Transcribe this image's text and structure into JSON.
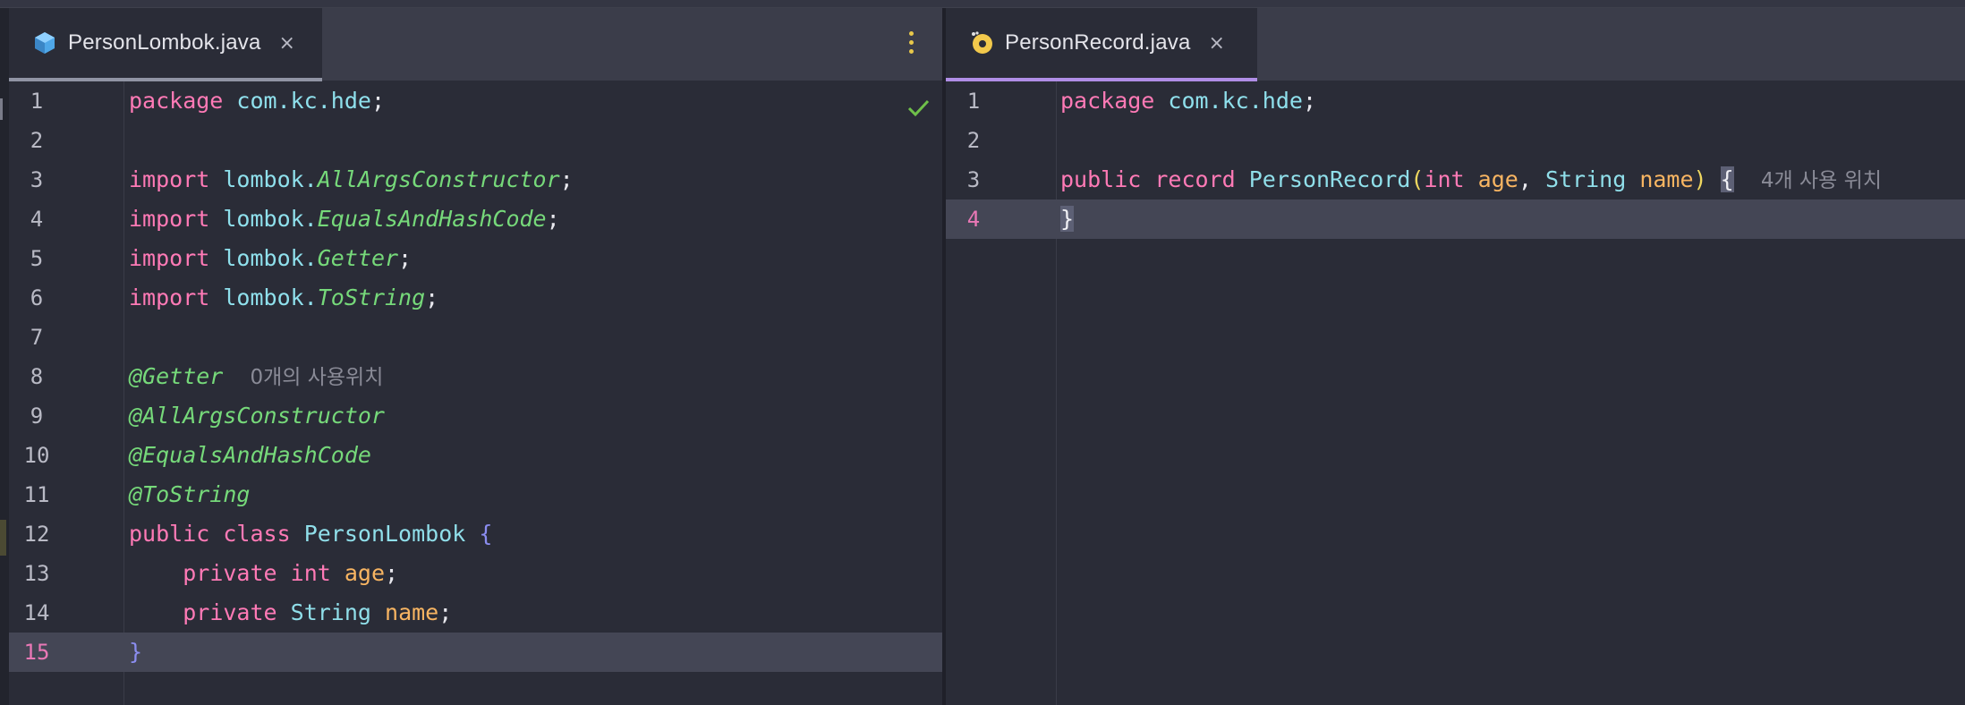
{
  "editor": {
    "left": {
      "tab": {
        "label": "PersonLombok.java",
        "close": "×",
        "icon": "java-class-icon"
      },
      "menu_icon": "vertical-ellipsis-icon",
      "status_icon": "checkmark-icon",
      "current_line": "15",
      "lines": [
        {
          "n": "1"
        },
        {
          "n": "2"
        },
        {
          "n": "3"
        },
        {
          "n": "4"
        },
        {
          "n": "5"
        },
        {
          "n": "6"
        },
        {
          "n": "7"
        },
        {
          "n": "8"
        },
        {
          "n": "9"
        },
        {
          "n": "10"
        },
        {
          "n": "11"
        },
        {
          "n": "12"
        },
        {
          "n": "13"
        },
        {
          "n": "14"
        },
        {
          "n": "15"
        }
      ],
      "tokens": {
        "package": "package",
        "pkg_name": "com.kc.hde",
        "semicolon": ";",
        "import": "import",
        "lombok": "lombok.",
        "AllArgsConstructor": "AllArgsConstructor",
        "EqualsAndHashCode": "EqualsAndHashCode",
        "Getter": "Getter",
        "ToString": "ToString",
        "at_getter": "@Getter",
        "getter_hint": "0개의 사용위치",
        "at_allargs": "@AllArgsConstructor",
        "at_equals": "@EqualsAndHashCode",
        "at_tostring": "@ToString",
        "public": "public",
        "class": "class",
        "class_name": "PersonLombok",
        "open_brace": "{",
        "close_brace": "}",
        "private": "private",
        "int": "int",
        "age": "age",
        "string": "String",
        "name": "name"
      }
    },
    "right": {
      "tab": {
        "label": "PersonRecord.java",
        "close": "×",
        "icon": "java-record-icon"
      },
      "current_line": "4",
      "lines": [
        {
          "n": "1"
        },
        {
          "n": "2"
        },
        {
          "n": "3"
        },
        {
          "n": "4"
        }
      ],
      "tokens": {
        "package": "package",
        "pkg_name": "com.kc.hde",
        "semicolon": ";",
        "public": "public",
        "record": "record",
        "record_name": "PersonRecord",
        "open_paren": "(",
        "int": "int",
        "age": "age",
        "comma": ",",
        "string": "String",
        "name": "name",
        "close_paren": ")",
        "open_brace": "{",
        "usage_hint": "4개 사용 위치",
        "close_brace": "}"
      }
    }
  },
  "colors": {
    "keyword": "#ff7ab6",
    "package": "#8fe0ec",
    "annotation": "#76d97a",
    "parameter": "#f8b562",
    "brace": "#8b8df0",
    "paren": "#f0d860",
    "hint": "#8a8b97",
    "background": "#2a2c37",
    "tab_bar": "#3b3d4a",
    "current_line": "#444655"
  }
}
